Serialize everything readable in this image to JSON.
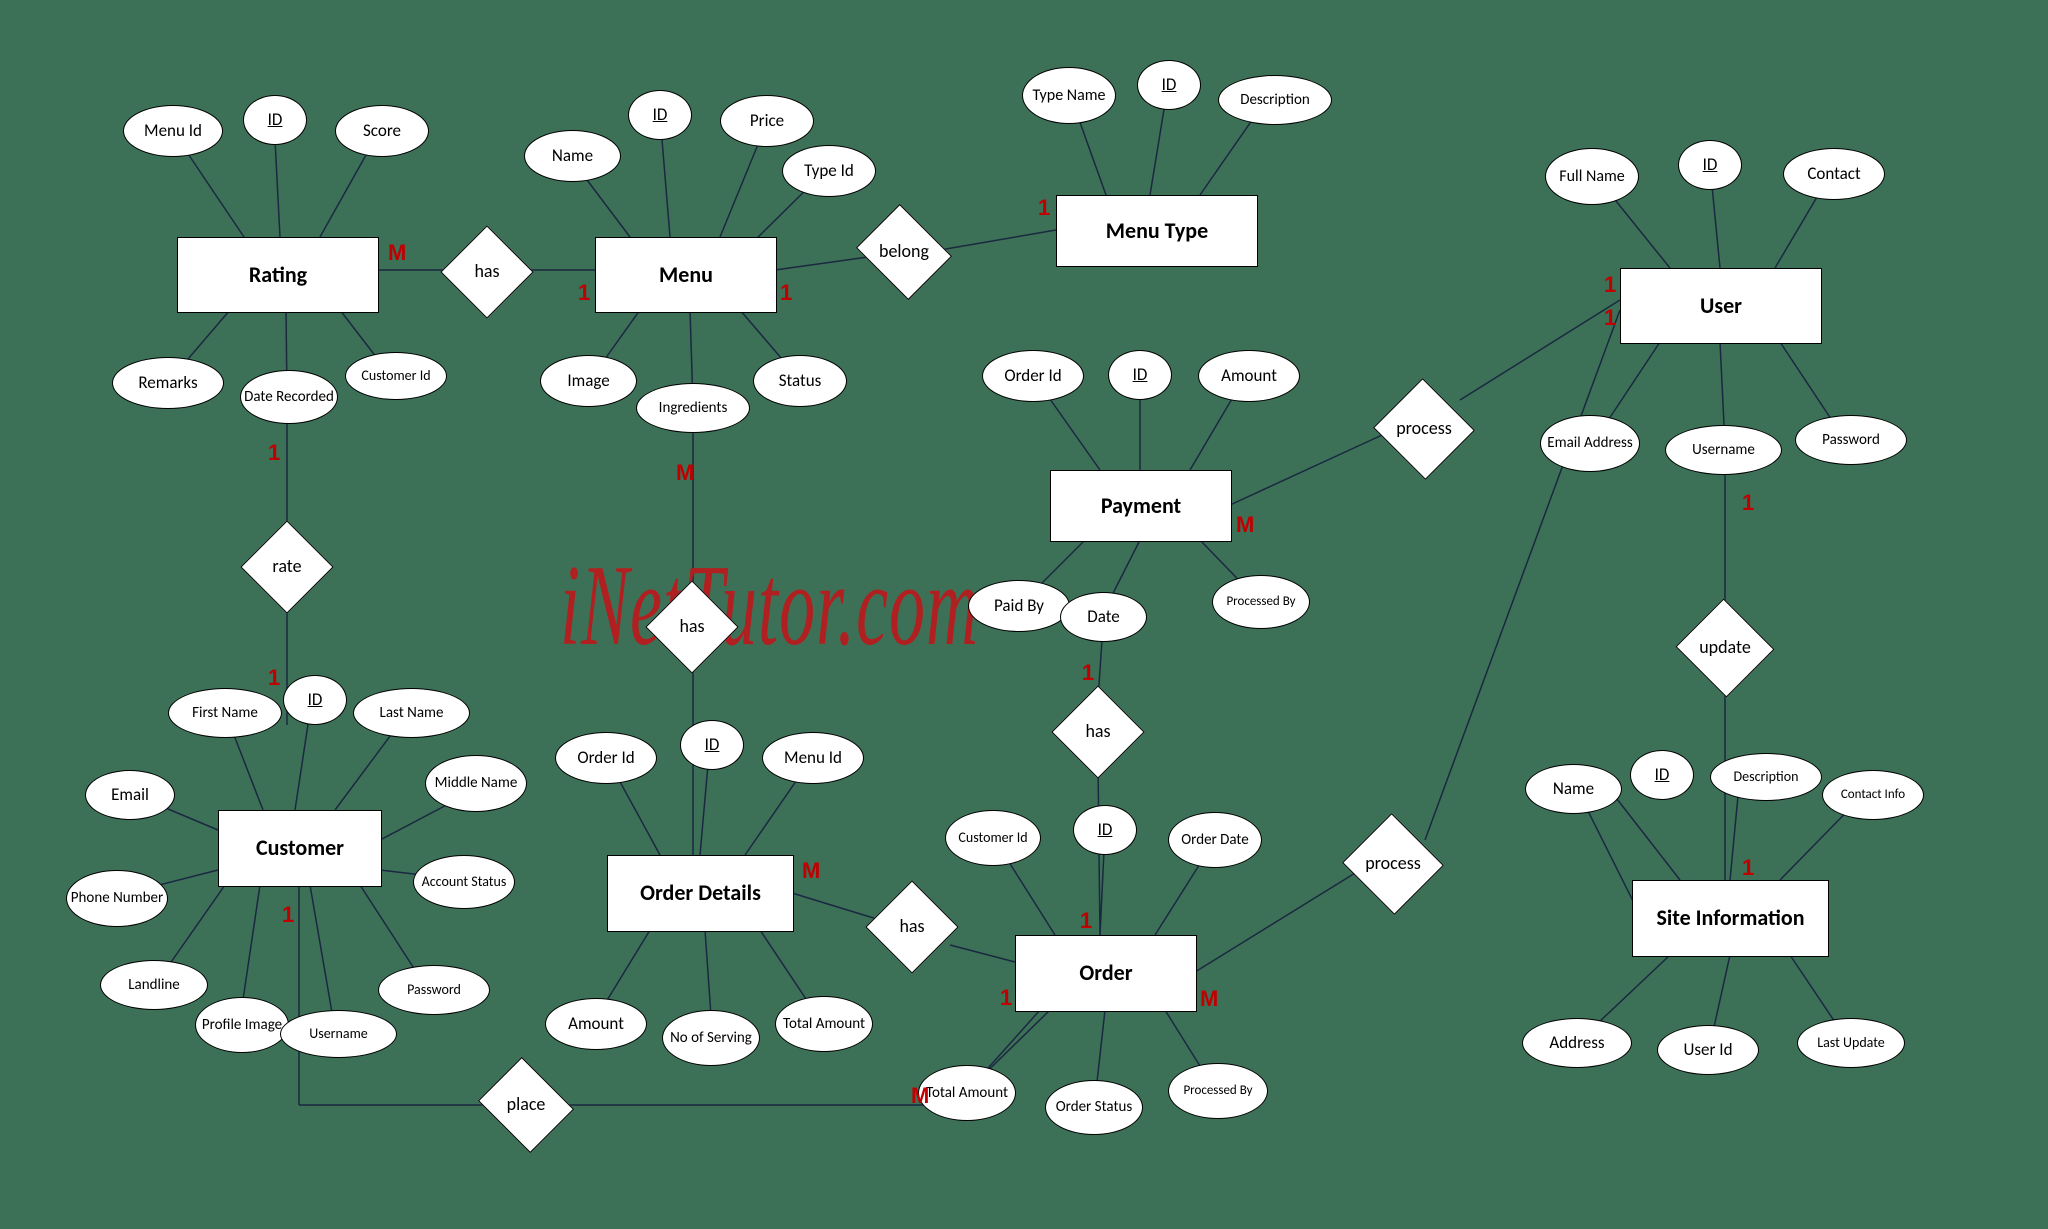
{
  "watermark": "iNetTutor.com",
  "entities": {
    "rating": "Rating",
    "menu": "Menu",
    "menutype": "Menu Type",
    "user": "User",
    "customer": "Customer",
    "orderdetails": "Order Details",
    "payment": "Payment",
    "order": "Order",
    "siteinfo": "Site Information"
  },
  "attrs": {
    "rating_menuid": "Menu Id",
    "rating_id": "ID",
    "rating_score": "Score",
    "rating_remarks": "Remarks",
    "rating_date": "Date Recorded",
    "rating_custid": "Customer Id",
    "menu_name": "Name",
    "menu_id": "ID",
    "menu_price": "Price",
    "menu_typeid": "Type Id",
    "menu_image": "Image",
    "menu_ingredients": "Ingredients",
    "menu_status": "Status",
    "mt_typename": "Type Name",
    "mt_id": "ID",
    "mt_desc": "Description",
    "user_fullname": "Full Name",
    "user_id": "ID",
    "user_contact": "Contact",
    "user_email": "Email Address",
    "user_username": "Username",
    "user_password": "Password",
    "pay_orderid": "Order Id",
    "pay_id": "ID",
    "pay_amount": "Amount",
    "pay_paidby": "Paid By",
    "pay_date": "Date",
    "pay_procby": "Processed By",
    "cust_fname": "First Name",
    "cust_id": "ID",
    "cust_lname": "Last Name",
    "cust_mname": "Middle Name",
    "cust_email": "Email",
    "cust_phone": "Phone Number",
    "cust_landline": "Landline",
    "cust_profile": "Profile Image",
    "cust_username": "Username",
    "cust_password": "Password",
    "cust_status": "Account Status",
    "od_orderid": "Order Id",
    "od_id": "ID",
    "od_menuid": "Menu Id",
    "od_amount": "Amount",
    "od_serving": "No of Serving",
    "od_total": "Total Amount",
    "ord_custid": "Customer Id",
    "ord_id": "ID",
    "ord_date": "Order Date",
    "ord_total": "Total Amount",
    "ord_status": "Order Status",
    "ord_procby": "Processed By",
    "site_id": "ID",
    "site_name": "Name",
    "site_desc": "Description",
    "site_contact": "Contact Info",
    "site_addr": "Address",
    "site_userid": "User Id",
    "site_update": "Last Update"
  },
  "rels": {
    "has1": "has",
    "belong": "belong",
    "rate": "rate",
    "has2": "has",
    "has3": "has",
    "has4": "has",
    "place": "place",
    "process1": "process",
    "process2": "process",
    "update": "update"
  },
  "cards": {
    "c1": "M",
    "c2": "1",
    "c3": "1",
    "c4": "1",
    "c5": "M",
    "c6": "1",
    "c7": "1",
    "c8": "1",
    "c9": "M",
    "c10": "1",
    "c11": "1",
    "c12": "M",
    "c13": "1",
    "c14": "M",
    "c15": "1",
    "c16": "1",
    "c17": "M",
    "c18": "1",
    "c19": "1"
  },
  "chart_data": {
    "type": "diagram",
    "subtype": "ER",
    "entities": [
      {
        "name": "Rating",
        "attributes": [
          "Menu Id",
          "ID",
          "Score",
          "Remarks",
          "Date Recorded",
          "Customer Id"
        ],
        "key": "ID"
      },
      {
        "name": "Menu",
        "attributes": [
          "Name",
          "ID",
          "Price",
          "Type Id",
          "Image",
          "Ingredients",
          "Status"
        ],
        "key": "ID"
      },
      {
        "name": "Menu Type",
        "attributes": [
          "Type Name",
          "ID",
          "Description"
        ],
        "key": "ID"
      },
      {
        "name": "User",
        "attributes": [
          "Full Name",
          "ID",
          "Contact",
          "Email Address",
          "Username",
          "Password"
        ],
        "key": "ID"
      },
      {
        "name": "Payment",
        "attributes": [
          "Order Id",
          "ID",
          "Amount",
          "Paid By",
          "Date",
          "Processed By"
        ],
        "key": "ID"
      },
      {
        "name": "Customer",
        "attributes": [
          "First Name",
          "ID",
          "Last Name",
          "Middle Name",
          "Email",
          "Phone Number",
          "Landline",
          "Profile Image",
          "Username",
          "Password",
          "Account Status"
        ],
        "key": "ID"
      },
      {
        "name": "Order Details",
        "attributes": [
          "Order Id",
          "ID",
          "Menu Id",
          "Amount",
          "No of Serving",
          "Total Amount"
        ],
        "key": "ID"
      },
      {
        "name": "Order",
        "attributes": [
          "Customer Id",
          "ID",
          "Order Date",
          "Total Amount",
          "Order Status",
          "Processed By"
        ],
        "key": "ID"
      },
      {
        "name": "Site Information",
        "attributes": [
          "ID",
          "Name",
          "Description",
          "Contact Info",
          "Address",
          "User Id",
          "Last Update"
        ],
        "key": "ID"
      }
    ],
    "relationships": [
      {
        "name": "has",
        "between": [
          "Rating",
          "Menu"
        ],
        "cardinality": [
          "M",
          "1"
        ]
      },
      {
        "name": "belong",
        "between": [
          "Menu",
          "Menu Type"
        ],
        "cardinality": [
          "1",
          "1"
        ]
      },
      {
        "name": "rate",
        "between": [
          "Rating",
          "Customer"
        ],
        "cardinality": [
          "1",
          "1"
        ]
      },
      {
        "name": "has",
        "between": [
          "Menu",
          "Order Details"
        ],
        "cardinality": [
          "M",
          "M"
        ]
      },
      {
        "name": "has",
        "between": [
          "Order Details",
          "Order"
        ],
        "cardinality": [
          "1",
          "1"
        ]
      },
      {
        "name": "has",
        "between": [
          "Payment",
          "Order"
        ],
        "cardinality": [
          "1",
          "1"
        ]
      },
      {
        "name": "place",
        "between": [
          "Customer",
          "Order"
        ],
        "cardinality": [
          "1",
          "M"
        ]
      },
      {
        "name": "process",
        "between": [
          "Payment",
          "User"
        ],
        "cardinality": [
          "M",
          "1"
        ]
      },
      {
        "name": "process",
        "between": [
          "Order",
          "User"
        ],
        "cardinality": [
          "M",
          "1"
        ]
      },
      {
        "name": "update",
        "between": [
          "User",
          "Site Information"
        ],
        "cardinality": [
          "1",
          "1"
        ]
      }
    ]
  }
}
